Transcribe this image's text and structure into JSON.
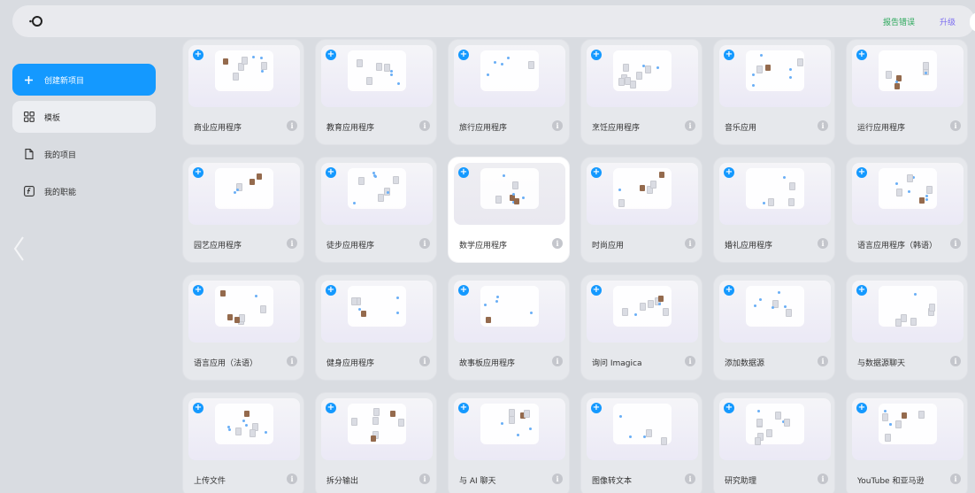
{
  "header": {
    "report_label": "报告错误",
    "upgrade_label": "升级"
  },
  "sidebar": {
    "items": [
      {
        "label": "创建新项目",
        "icon": "plus-icon"
      },
      {
        "label": "模板",
        "icon": "grid-icon"
      },
      {
        "label": "我的项目",
        "icon": "file-icon"
      },
      {
        "label": "我的职能",
        "icon": "function-icon"
      }
    ]
  },
  "templates": [
    {
      "label": "商业应用程序"
    },
    {
      "label": "教育应用程序"
    },
    {
      "label": "旅行应用程序"
    },
    {
      "label": "烹饪应用程序"
    },
    {
      "label": "音乐应用"
    },
    {
      "label": "运行应用程序"
    },
    {
      "label": "园艺应用程序"
    },
    {
      "label": "徒步应用程序"
    },
    {
      "label": "数学应用程序"
    },
    {
      "label": "时尚应用"
    },
    {
      "label": "婚礼应用程序"
    },
    {
      "label": "语言应用程序（韩语）"
    },
    {
      "label": "语言应用（法语）"
    },
    {
      "label": "健身应用程序"
    },
    {
      "label": "故事板应用程序"
    },
    {
      "label": "询问 Imagica"
    },
    {
      "label": "添加数据源"
    },
    {
      "label": "与数据源聊天"
    },
    {
      "label": "上传文件"
    },
    {
      "label": "拆分输出"
    },
    {
      "label": "与 AI 聊天"
    },
    {
      "label": "图像转文本"
    },
    {
      "label": "研究助理"
    },
    {
      "label": "YouTube 和亚马逊"
    }
  ],
  "colors": {
    "accent": "#1499ff",
    "report": "#2aa85a",
    "upgrade": "#7b6cf0"
  }
}
